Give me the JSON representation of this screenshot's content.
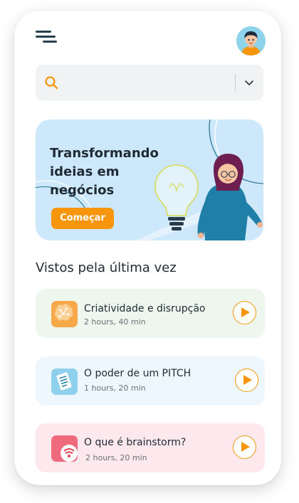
{
  "header": {
    "menu_icon": "hamburger-menu-icon",
    "avatar_icon": "user-avatar"
  },
  "search": {
    "placeholder": "",
    "icon": "search-icon",
    "dropdown_icon": "chevron-down-icon",
    "accent": "#f7950c"
  },
  "banner": {
    "title": "Transformando ideias em negócios",
    "button_label": "Começar",
    "background": "#cde8fb",
    "button_color": "#f7950c"
  },
  "recent": {
    "title": "Vistos pela última vez",
    "items": [
      {
        "title": "Criatividade e disrupção",
        "duration": "2 hours, 40 min",
        "icon": "brain-circuit-icon",
        "background": "#eef7ee"
      },
      {
        "title": "O poder de um PITCH",
        "duration": "1 hours, 20 min",
        "icon": "document-icon",
        "background": "#eef7fd"
      },
      {
        "title": "O que é brainstorm?",
        "duration": "2 hours, 20 min",
        "icon": "brainstorm-icon",
        "background": "#fde8ee"
      }
    ]
  }
}
